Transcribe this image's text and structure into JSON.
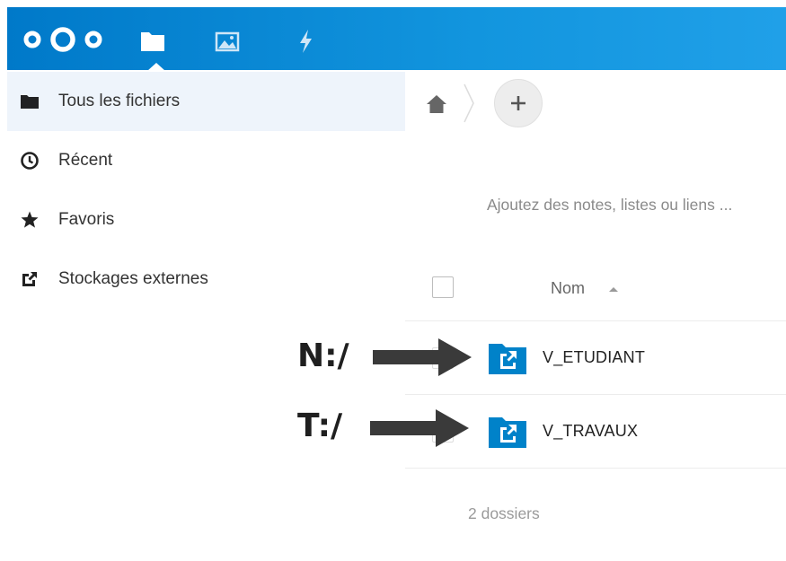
{
  "header": {
    "logo": "nextcloud-logo",
    "apps": [
      {
        "name": "files",
        "icon": "folder-icon",
        "active": true
      },
      {
        "name": "photos",
        "icon": "image-icon",
        "active": false
      },
      {
        "name": "activity",
        "icon": "lightning-icon",
        "active": false
      }
    ],
    "colors": {
      "gradient_start": "#0079c9",
      "gradient_end": "#20a0e8"
    }
  },
  "sidebar": {
    "items": [
      {
        "label": "Tous les fichiers",
        "icon": "folder-icon",
        "active": true
      },
      {
        "label": "Récent",
        "icon": "clock-icon",
        "active": false
      },
      {
        "label": "Favoris",
        "icon": "star-icon",
        "active": false
      },
      {
        "label": "Stockages externes",
        "icon": "external-link-icon",
        "active": false
      }
    ]
  },
  "main": {
    "breadcrumb": {
      "home_icon": "home-icon",
      "add_icon": "plus-icon"
    },
    "notes_placeholder": "Ajoutez des notes, listes ou liens ...",
    "table": {
      "column_name": "Nom",
      "rows": [
        {
          "name": "V_ETUDIANT",
          "icon": "external-folder-icon"
        },
        {
          "name": "V_TRAVAUX",
          "icon": "external-folder-icon"
        }
      ]
    },
    "summary": "2 dossiers"
  },
  "annotations": [
    {
      "label": "N:/",
      "points_to": "V_ETUDIANT"
    },
    {
      "label": "T:/",
      "points_to": "V_TRAVAUX"
    }
  ]
}
